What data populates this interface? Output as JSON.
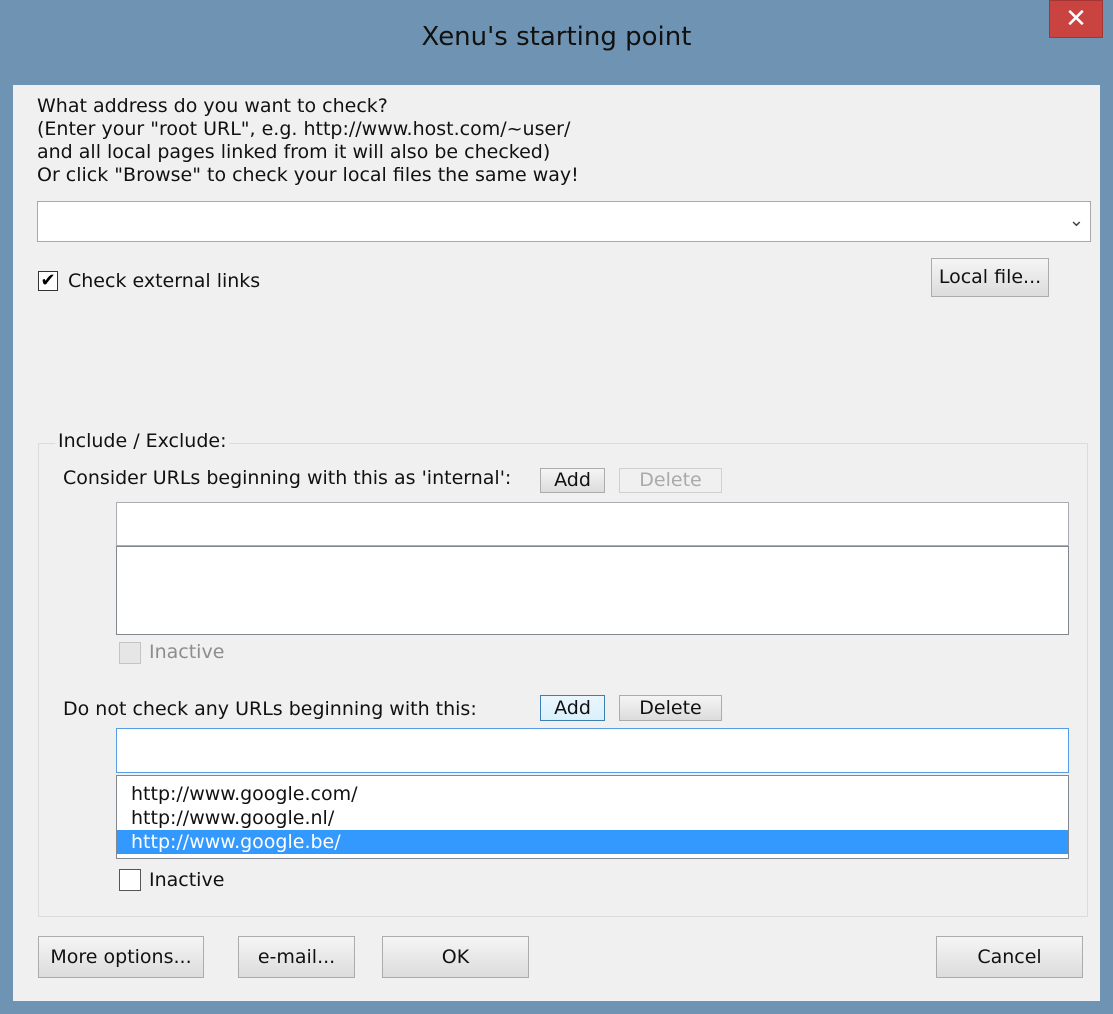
{
  "window": {
    "title": "Xenu's starting point",
    "close_glyph": "✕"
  },
  "prompt": {
    "lines": [
      "What address do you want to check?",
      "(Enter your \"root URL\", e.g. http://www.host.com/~user/",
      "and all local pages linked from it will also be checked)",
      "Or click \"Browse\" to check your local files the same way!"
    ]
  },
  "address_combo": {
    "value": "",
    "arrow_glyph": "⌄"
  },
  "check_external": {
    "label": "Check external links",
    "checked_glyph": "✔"
  },
  "local_file_button": "Local file...",
  "include_exclude": {
    "legend": "Include / Exclude:",
    "internal": {
      "label": "Consider URLs beginning with this as 'internal':",
      "add_label": "Add",
      "delete_label": "Delete",
      "input_value": "",
      "items": [],
      "inactive_label": "Inactive"
    },
    "exclude": {
      "label": "Do not check any URLs beginning with this:",
      "add_label": "Add",
      "delete_label": "Delete",
      "input_value": "",
      "items": [
        "http://www.google.com/",
        "http://www.google.nl/",
        "http://www.google.be/"
      ],
      "selected_index": 2,
      "inactive_label": "Inactive"
    }
  },
  "footer": {
    "more_options": "More options...",
    "email": "e-mail...",
    "ok": "OK",
    "cancel": "Cancel"
  },
  "colors": {
    "frame": "#6f94b3",
    "close": "#c94340",
    "selection": "#3399ff"
  }
}
